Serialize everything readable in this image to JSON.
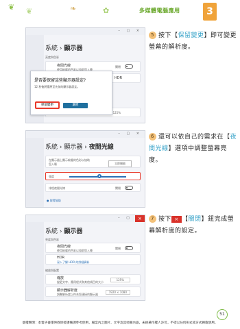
{
  "header": {
    "chapter_title": "多媒體電腦應用",
    "chapter_number": "3",
    "accent": "#f0a33a"
  },
  "shot1": {
    "breadcrumb_parent": "系統",
    "breadcrumb_current": "顯示器",
    "section": "亮度與色彩",
    "row1_title": "夜間光線",
    "row1_sub": "使用較暖的色彩以協助您入睡",
    "row1_state": "關閉",
    "row2_title": "HDR",
    "dialog_title": "是否要保留這些顯示器設定?",
    "dialog_text": "12 秒後將還原至先前的顯示器設定。",
    "keep_label": "保留變更",
    "revert_label": "還原",
    "scale_value": "125%"
  },
  "shot2": {
    "breadcrumb_parent": "系統",
    "breadcrumb_mid": "顯示器",
    "breadcrumb_current": "夜間光線",
    "row1_text": "在顯示器上顯示較暖的色彩以協助您入睡",
    "row1_button": "立即開啟",
    "slider_label": "強度",
    "slider_value": 0.55,
    "schedule_label": "排程夜間光線",
    "schedule_state": "關閉",
    "help_link": "取得協助"
  },
  "shot3": {
    "breadcrumb_parent": "系統",
    "breadcrumb_current": "顯示器",
    "section1": "亮度與色彩",
    "row1_title": "夜間光線",
    "row1_sub": "使用較暖的色彩以協助您入睡",
    "row1_state": "關閉",
    "row2_title": "HDR",
    "row2_link": "深入了解 HDR 的詳細資料",
    "section2": "縮放與配置",
    "row3_title": "縮放",
    "row3_sub": "變更文字、應用程式和其他項目的大小",
    "row3_value": "125%",
    "row4_title": "顯示器解析度",
    "row4_sub": "調整解析度以符合您連接的顯示器",
    "row4_value": "1920 × 1080",
    "close_glyph": "×"
  },
  "steps": [
    {
      "num": "5",
      "before": "按下【",
      "highlight": "保留變更",
      "after": "】即可變更螢幕的解析度。"
    },
    {
      "num": "6",
      "before": "還可以依自己的需求在【",
      "highlight": "夜間光線",
      "after": "】選項中調整螢幕亮度。"
    },
    {
      "num": "7",
      "before": "按下",
      "highlight": "關閉",
      "after": "鈕完成螢幕解析度的設定。"
    }
  ],
  "footer": {
    "page_number": "51",
    "notice": "版權聲明：本電子書僅供教師授課備課參考使用，檔案內之圖片、文字及其他關內容，未經著作權人許可，不得以任何形式或方式轉載使用。"
  }
}
